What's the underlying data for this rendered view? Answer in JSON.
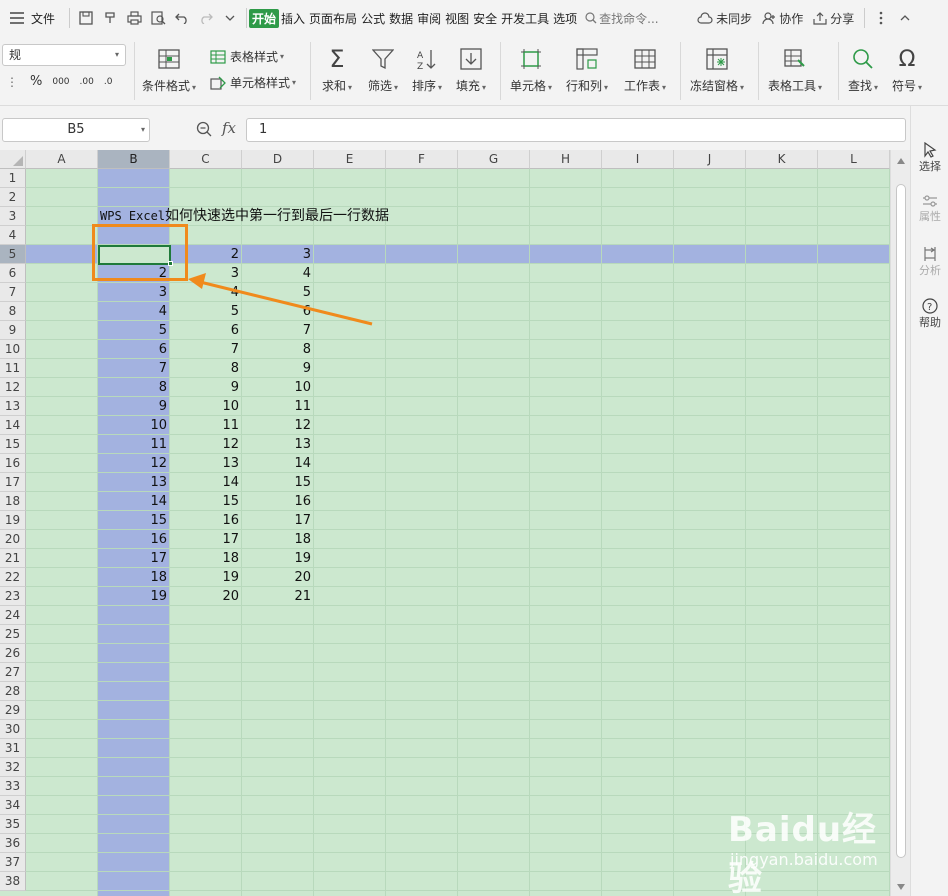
{
  "menubar": {
    "file": "文件",
    "tabs": [
      "开始",
      "插入",
      "页面布局",
      "公式",
      "数据",
      "审阅",
      "视图",
      "安全",
      "开发工具",
      "选项"
    ],
    "active_tab": "开始",
    "search_placeholder": "查找命令...",
    "sync": "未同步",
    "collab": "协作",
    "share": "分享"
  },
  "ribbon": {
    "number_format": "规",
    "conditional_format": "条件格式",
    "table_style": "表格样式",
    "cell_style": "单元格样式",
    "sum": "求和",
    "filter": "筛选",
    "sort": "排序",
    "fill": "填充",
    "cell": "单元格",
    "row_col": "行和列",
    "worksheet": "工作表",
    "freeze": "冻结窗格",
    "table_tools": "表格工具",
    "find": "查找",
    "symbol": "符号",
    "percent": "%",
    "thousands": "000",
    "dec_inc": ".00",
    "dec_dec": ".0"
  },
  "formulabar": {
    "name_box": "B5",
    "fx": "fx",
    "formula": "1"
  },
  "grid": {
    "columns": [
      "A",
      "B",
      "C",
      "D",
      "E",
      "F",
      "G",
      "H",
      "I",
      "J",
      "K",
      "L"
    ],
    "rows": [
      "1",
      "2",
      "3",
      "4",
      "5",
      "6",
      "7",
      "8",
      "9",
      "10",
      "11",
      "12",
      "13",
      "14",
      "15",
      "16",
      "17",
      "18",
      "19",
      "20",
      "21",
      "22",
      "23",
      "24",
      "25",
      "26",
      "27",
      "28",
      "29",
      "30",
      "31",
      "32",
      "33",
      "34",
      "35",
      "36",
      "37",
      "38"
    ],
    "title_mono": "WPS Excel",
    "title_rest": "如何快速选中第一行到最后一行数据",
    "data_rows": [
      [
        "1",
        "2",
        "3"
      ],
      [
        "2",
        "3",
        "4"
      ],
      [
        "3",
        "4",
        "5"
      ],
      [
        "4",
        "5",
        "6"
      ],
      [
        "5",
        "6",
        "7"
      ],
      [
        "6",
        "7",
        "8"
      ],
      [
        "7",
        "8",
        "9"
      ],
      [
        "8",
        "9",
        "10"
      ],
      [
        "9",
        "10",
        "11"
      ],
      [
        "10",
        "11",
        "12"
      ],
      [
        "11",
        "12",
        "13"
      ],
      [
        "12",
        "13",
        "14"
      ],
      [
        "13",
        "14",
        "15"
      ],
      [
        "14",
        "15",
        "16"
      ],
      [
        "15",
        "16",
        "17"
      ],
      [
        "16",
        "17",
        "18"
      ],
      [
        "17",
        "18",
        "19"
      ],
      [
        "18",
        "19",
        "20"
      ],
      [
        "19",
        "20",
        "21"
      ]
    ]
  },
  "rightpanel": {
    "select": "选择",
    "properties": "属性",
    "analysis": "分析",
    "help": "帮助"
  },
  "watermark": {
    "brand": "Baidu经验",
    "url": "jingyan.baidu.com"
  },
  "colors": {
    "accent": "#2e9a48",
    "sheet_bg": "#cce8cf",
    "selection": "#a3b2e0",
    "annotation": "#f08a1c"
  }
}
